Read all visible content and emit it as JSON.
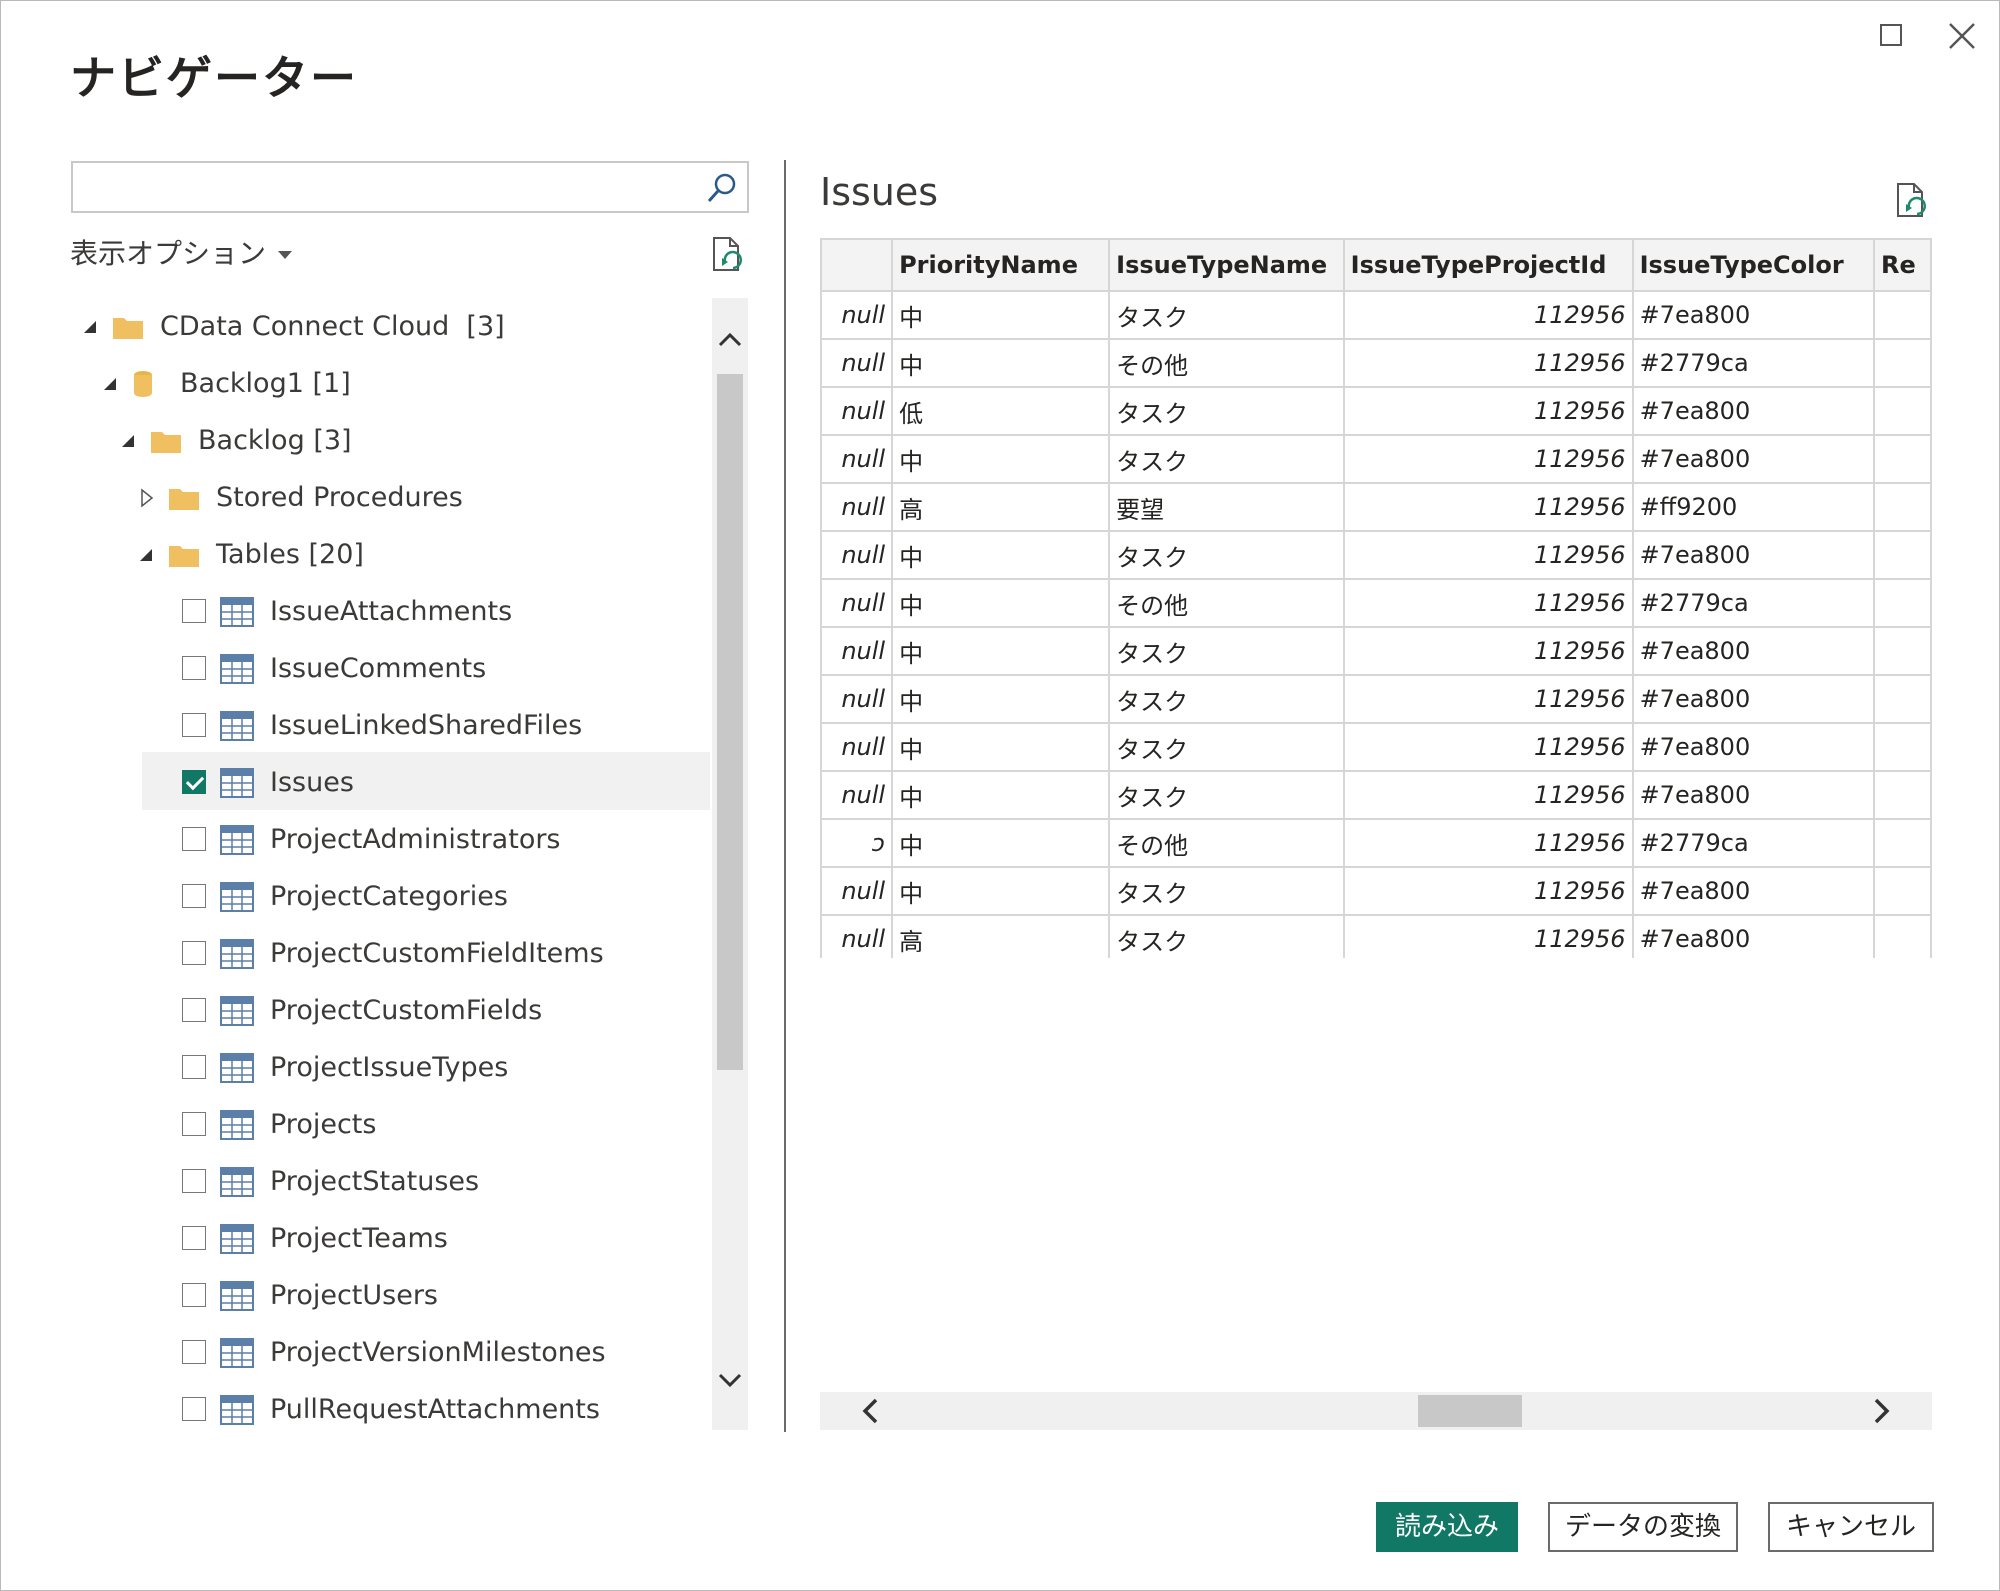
{
  "window": {
    "title": "ナビゲーター"
  },
  "search": {
    "value": "",
    "placeholder": ""
  },
  "display_options": {
    "label": "表示オプション"
  },
  "tree": {
    "root": {
      "label": "CData Connect Cloud",
      "count": "[3]"
    },
    "db": {
      "label": "Backlog1",
      "count": "[1]"
    },
    "schema": {
      "label": "Backlog",
      "count": "[3]"
    },
    "stored": {
      "label": "Stored Procedures"
    },
    "tables": {
      "label": "Tables",
      "count": "[20]"
    },
    "items": [
      {
        "label": "IssueAttachments",
        "checked": false
      },
      {
        "label": "IssueComments",
        "checked": false
      },
      {
        "label": "IssueLinkedSharedFiles",
        "checked": false
      },
      {
        "label": "Issues",
        "checked": true
      },
      {
        "label": "ProjectAdministrators",
        "checked": false
      },
      {
        "label": "ProjectCategories",
        "checked": false
      },
      {
        "label": "ProjectCustomFieldItems",
        "checked": false
      },
      {
        "label": "ProjectCustomFields",
        "checked": false
      },
      {
        "label": "ProjectIssueTypes",
        "checked": false
      },
      {
        "label": "Projects",
        "checked": false
      },
      {
        "label": "ProjectStatuses",
        "checked": false
      },
      {
        "label": "ProjectTeams",
        "checked": false
      },
      {
        "label": "ProjectUsers",
        "checked": false
      },
      {
        "label": "ProjectVersionMilestones",
        "checked": false
      },
      {
        "label": "PullRequestAttachments",
        "checked": false
      }
    ]
  },
  "preview": {
    "title": "Issues",
    "columns": [
      "",
      "PriorityName",
      "IssueTypeName",
      "IssueTypeProjectId",
      "IssueTypeColor",
      "Re"
    ],
    "rows": [
      [
        "null",
        "中",
        "タスク",
        "112956",
        "#7ea800"
      ],
      [
        "null",
        "中",
        "その他",
        "112956",
        "#2779ca"
      ],
      [
        "null",
        "低",
        "タスク",
        "112956",
        "#7ea800"
      ],
      [
        "null",
        "中",
        "タスク",
        "112956",
        "#7ea800"
      ],
      [
        "null",
        "高",
        "要望",
        "112956",
        "#ff9200"
      ],
      [
        "null",
        "中",
        "タスク",
        "112956",
        "#7ea800"
      ],
      [
        "null",
        "中",
        "その他",
        "112956",
        "#2779ca"
      ],
      [
        "null",
        "中",
        "タスク",
        "112956",
        "#7ea800"
      ],
      [
        "null",
        "中",
        "タスク",
        "112956",
        "#7ea800"
      ],
      [
        "null",
        "中",
        "タスク",
        "112956",
        "#7ea800"
      ],
      [
        "null",
        "中",
        "タスク",
        "112956",
        "#7ea800"
      ],
      [
        "ɔ",
        "中",
        "その他",
        "112956",
        "#2779ca"
      ],
      [
        "null",
        "中",
        "タスク",
        "112956",
        "#7ea800"
      ],
      [
        "null",
        "高",
        "タスク",
        "112956",
        "#7ea800"
      ]
    ]
  },
  "buttons": {
    "load": "読み込み",
    "transform": "データの変換",
    "cancel": "キャンセル"
  },
  "colors": {
    "accent": "#117865",
    "folder": "#f0c060"
  }
}
